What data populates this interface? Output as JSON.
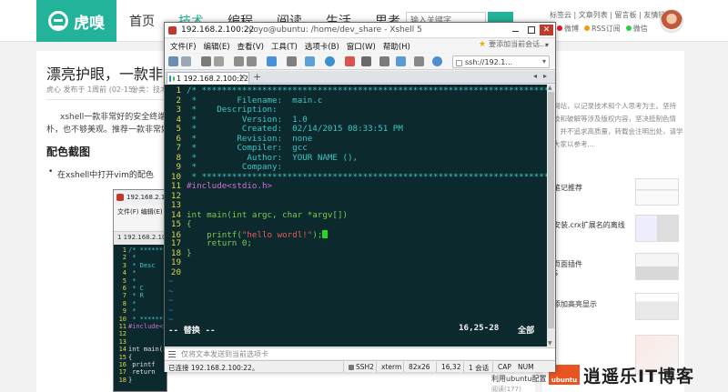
{
  "site": {
    "logo_text": "虎嗅",
    "nav": [
      "首页",
      "技术",
      "编程",
      "阅读",
      "生活",
      "思考"
    ],
    "search_placeholder": "输入关键字",
    "top_links": "标签云 | 文章列表 | 留言板 | 友情链接",
    "social": [
      "微博",
      "RSS订阅",
      "微信"
    ]
  },
  "article": {
    "title": "漂亮护眼，一款非常",
    "meta": "虎心 发布于 1周前 (02-15)",
    "category": "分类：技术",
    "p1": "xshell一款非常好的安全终端模",
    "p2": "朴，也不够美观。推荐一款非常好的",
    "h2": "配色截图",
    "li": "在xshell中打开vim的配色"
  },
  "sidebar": {
    "intro": [
      "网站，以记录技术和个人思考为主。坚持",
      "技和破解等涉及版权内容，坚决抵制色情",
      "，并不追求高质量，转载会注明出处，请学",
      "大家以参考..."
    ],
    "items": [
      "笔记推荐",
      "安装.crx扩展名的离线",
      "S",
      "页面插件",
      "添加高亮显示"
    ],
    "bottom_title": "利用ubuntu配置",
    "bottom_meta": "阅读(177)",
    "watermark_badge": "ubuntu",
    "watermark_text": "逍遥乐IT博客"
  },
  "xshell_back": {
    "title": "192.168.2.100:22",
    "menu": "文件(F)  编辑(E)  查",
    "tab": "1 192.168.2.100",
    "lines": [
      {
        "n": "1",
        "t": "/* *******"
      },
      {
        "n": "2",
        "t": " *      "
      },
      {
        "n": "3",
        "t": " *    Desc"
      },
      {
        "n": "4",
        "t": " *     "
      },
      {
        "n": "5",
        "t": " *      "
      },
      {
        "n": "6",
        "t": " *      C"
      },
      {
        "n": "7",
        "t": " *     R"
      },
      {
        "n": "8",
        "t": " *      "
      },
      {
        "n": "9",
        "t": " *      "
      },
      {
        "n": "10",
        "t": " * *******"
      },
      {
        "n": "11",
        "t": "#include<s"
      },
      {
        "n": "12",
        "t": ""
      },
      {
        "n": "13",
        "t": ""
      },
      {
        "n": "14",
        "t": "int main(i"
      },
      {
        "n": "15",
        "t": "{"
      },
      {
        "n": "16",
        "t": "    printf"
      },
      {
        "n": "17",
        "t": "    return"
      },
      {
        "n": "18",
        "t": "}"
      }
    ]
  },
  "xshell": {
    "title_host": "192.168.2.100:22",
    "title_rest": "yoyo@ubuntu: /home/dev_share - Xshell 5",
    "menu": [
      "文件(F)",
      "编辑(E)",
      "查看(V)",
      "工具(T)",
      "选项卡(B)",
      "窗口(W)",
      "帮助(H)"
    ],
    "add_address_hint": "要添加当前会话...",
    "address_value": "ssh://192.1...",
    "tab_label": "1 192.168.2.100:22",
    "code_lines": [
      {
        "n": "1",
        "cls": "c-comment",
        "t": "/* ***********************************************************************"
      },
      {
        "n": "2",
        "cls": "c-comment",
        "t": " *        Filename:  main.c"
      },
      {
        "n": "3",
        "cls": "c-comment",
        "t": " *    Description:"
      },
      {
        "n": "4",
        "cls": "c-comment",
        "t": " *         Version:  1.0"
      },
      {
        "n": "5",
        "cls": "c-comment",
        "t": " *         Created:  02/14/2015 08:33:51 PM"
      },
      {
        "n": "6",
        "cls": "c-comment",
        "t": " *        Revision:  none"
      },
      {
        "n": "7",
        "cls": "c-comment",
        "t": " *        Compiler:  gcc"
      },
      {
        "n": "8",
        "cls": "c-comment",
        "t": " *          Author:  YOUR NAME (),"
      },
      {
        "n": "9",
        "cls": "c-comment",
        "t": " *         Company:"
      },
      {
        "n": "10",
        "cls": "c-comment",
        "t": " * ***********************************************************************/"
      },
      {
        "n": "11",
        "cls": "c-inc",
        "t": "#include<stdio.h>"
      },
      {
        "n": "12",
        "cls": "c-plain",
        "t": ""
      },
      {
        "n": "13",
        "cls": "c-plain",
        "t": ""
      },
      {
        "n": "14",
        "cls": "c-type",
        "t": "int main(int argc, char *argv[])"
      },
      {
        "n": "15",
        "cls": "c-type",
        "t": "{"
      },
      {
        "n": "16",
        "cls": "c-type",
        "t": "    printf(\"hello wordl!\");"
      },
      {
        "n": "17",
        "cls": "c-type",
        "t": "    return 0;"
      },
      {
        "n": "18",
        "cls": "c-type",
        "t": "}"
      },
      {
        "n": "19",
        "cls": "c-plain",
        "t": ""
      },
      {
        "n": "20",
        "cls": "c-plain",
        "t": ""
      }
    ],
    "tilde_lines": [
      "~",
      "~",
      "~",
      "~",
      "~"
    ],
    "vim_mode": "-- 替换 --",
    "vim_position": "16,25-28",
    "vim_scope": "全部",
    "input_hint": "仅将文本发送到当前选项卡",
    "status": {
      "connection": "已连接 192.168.2.100:22。",
      "protocol": "SSH2",
      "terminal": "xterm",
      "size": "82x26",
      "cursor": "16,32",
      "sessions": "1 会话",
      "caps": "CAP",
      "num": "NUM"
    }
  },
  "colors": {
    "brand": "#22b39a",
    "terminal_bg": "#0c2a2e",
    "line_number": "#e2d34a",
    "comment": "#3fc5c5",
    "preprocessor": "#d070d0",
    "code": "#7ec850",
    "string": "#e85a5a",
    "cursor": "#2bd62b"
  }
}
